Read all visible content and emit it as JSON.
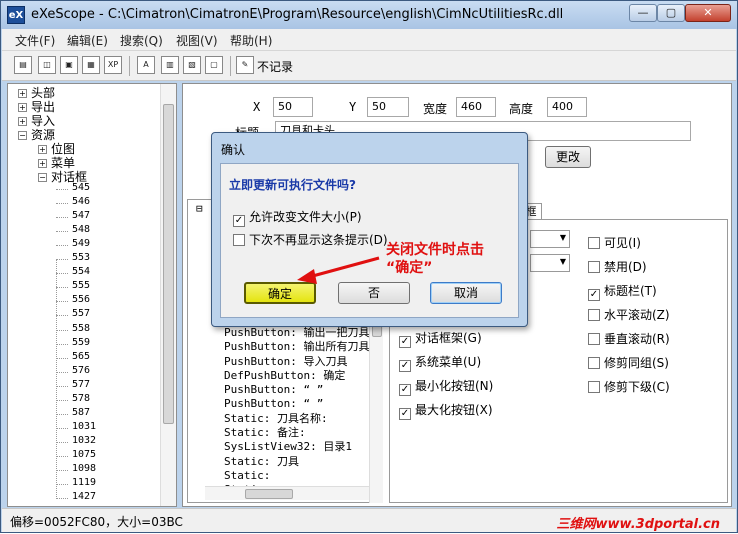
{
  "window": {
    "icon": "eX",
    "title": "eXeScope - C:\\Cimatron\\CimatronE\\Program\\Resource\\english\\CimNcUtilitiesRc.dll",
    "minimize": "—",
    "maximize": "▢",
    "close": "✕"
  },
  "menu": [
    "文件(F)",
    "编辑(E)",
    "搜索(Q)",
    "视图(V)",
    "帮助(H)"
  ],
  "toolbar": {
    "icons": [
      "save-icon",
      "open-icon",
      "disk-icon",
      "export-icon",
      "xp-icon",
      "font-icon",
      "dialog-icon",
      "image-icon",
      "window-icon",
      "log-icon"
    ],
    "xp_label": "XP",
    "nolog_label": "不记录"
  },
  "tree": {
    "top": [
      {
        "sign": "+",
        "label": "头部"
      },
      {
        "sign": "+",
        "label": "导出"
      },
      {
        "sign": "+",
        "label": "导入"
      },
      {
        "sign": "−",
        "label": "资源"
      }
    ],
    "sub": [
      {
        "sign": "+",
        "label": "位图"
      },
      {
        "sign": "+",
        "label": "菜单"
      },
      {
        "sign": "−",
        "label": "对话框"
      }
    ],
    "leaves": [
      "545",
      "546",
      "547",
      "548",
      "549",
      "553",
      "554",
      "555",
      "556",
      "557",
      "558",
      "559",
      "565",
      "576",
      "577",
      "578",
      "587",
      "1031",
      "1032",
      "1075",
      "1098",
      "1119",
      "1427"
    ]
  },
  "form": {
    "x_label": "X",
    "x_value": "50",
    "y_label": "Y",
    "y_value": "50",
    "width_label": "宽度",
    "width_value": "460",
    "height_label": "高度",
    "height_value": "400",
    "title_label": "标题",
    "title_value": "刀具和卡头",
    "change_button": "更改"
  },
  "controls": [
    "PushButton: 输出一把刀具",
    "PushButton: 输出所有刀具",
    "PushButton: 导入刀具",
    "DefPushButton: 确定",
    "PushButton: “ ”",
    "PushButton: “ ”",
    "Static: 刀具名称:",
    "Static: 备注:",
    "SysListView32: 目录1",
    "Static: 刀具",
    "Static:",
    "Static: …"
  ],
  "tab_label": "框",
  "props_left": [
    {
      "label": "对话框架(G)",
      "checked": true
    },
    {
      "label": "系统菜单(U)",
      "checked": true
    },
    {
      "label": "最小化按钮(N)",
      "checked": true
    },
    {
      "label": "最大化按钮(X)",
      "checked": true
    }
  ],
  "props_right": [
    {
      "label": "可见(I)",
      "checked": false
    },
    {
      "label": "禁用(D)",
      "checked": false
    },
    {
      "label": "标题栏(T)",
      "checked": true
    },
    {
      "label": "水平滚动(Z)",
      "checked": false
    },
    {
      "label": "垂直滚动(R)",
      "checked": false
    },
    {
      "label": "修剪同组(S)",
      "checked": false
    },
    {
      "label": "修剪下级(C)",
      "checked": false
    }
  ],
  "status": {
    "text": "偏移=0052FC80，大小=03BC",
    "watermark": "三维网www.3dportal.cn"
  },
  "dialog": {
    "title": "确认",
    "question": "立即更新可执行文件吗?",
    "check1": "允许改变文件大小(P)",
    "check1_checked": true,
    "check2": "下次不再显示这条提示(D)",
    "check2_checked": false,
    "ok": "确定",
    "no": "否",
    "cancel": "取消"
  },
  "annotation": {
    "line1": "关闭文件时点击",
    "line2": "“确定”",
    "color": "#e01010"
  }
}
